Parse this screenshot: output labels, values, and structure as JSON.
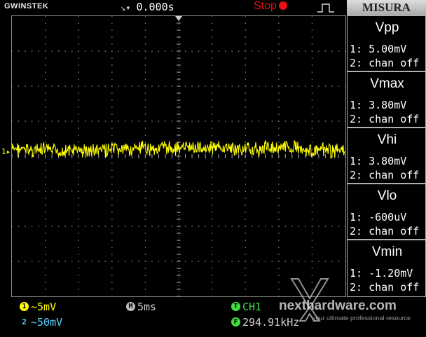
{
  "topbar": {
    "brand": "GWINSTEK",
    "trigger_symbol": "↘▾",
    "trigger_delay": "0.000s",
    "run_state": "Stop"
  },
  "panel": {
    "title": "MISURA",
    "measurements": [
      {
        "label": "Vpp",
        "ch1": "1: 5.00mV",
        "ch2": "2: chan off"
      },
      {
        "label": "Vmax",
        "ch1": "1: 3.80mV",
        "ch2": "2: chan off"
      },
      {
        "label": "Vhi",
        "ch1": "1: 3.80mV",
        "ch2": "2: chan off"
      },
      {
        "label": "Vlo",
        "ch1": "1: -600uV",
        "ch2": "2: chan off"
      },
      {
        "label": "Vmin",
        "ch1": "1: -1.20mV",
        "ch2": "2: chan off"
      }
    ]
  },
  "plot": {
    "channel_marker": "1▸",
    "trace_color": "#ffff00"
  },
  "bottombar": {
    "ch1_badge": "1",
    "ch1_scale": "~5mV",
    "ch2_badge": "2",
    "ch2_scale": "~50mV",
    "time_badge": "M",
    "time_scale": "5ms",
    "trig_badge": "T",
    "trig_source": "CH1",
    "freq_badge": "F",
    "freq_value": "294.91kHz",
    "watermark": "nexthardware.com",
    "watermark_sub": "your ultimate professional resource"
  },
  "colors": {
    "ch1": "#ffff00",
    "ch2": "#5ad0ff",
    "stop": "#e81010",
    "grid": "#8a8a8a"
  }
}
